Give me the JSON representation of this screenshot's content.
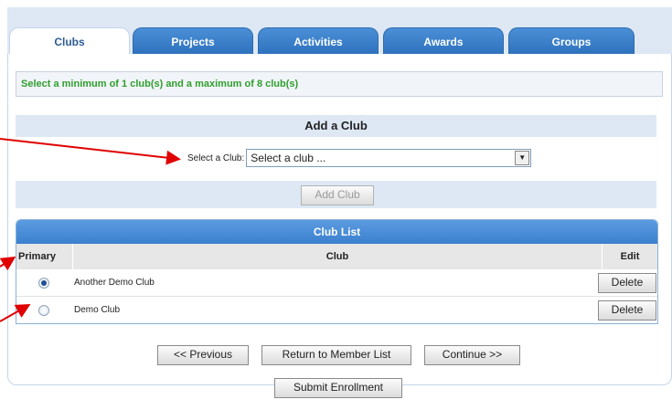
{
  "tabs": [
    {
      "label": "Clubs",
      "active": true
    },
    {
      "label": "Projects",
      "active": false
    },
    {
      "label": "Activities",
      "active": false
    },
    {
      "label": "Awards",
      "active": false
    },
    {
      "label": "Groups",
      "active": false
    }
  ],
  "notice": "Select a minimum of 1 club(s) and a maximum of 8 club(s)",
  "add_club": {
    "title": "Add a Club",
    "select_label": "Select a Club:",
    "select_value": "Select a club ...",
    "add_button": "Add Club"
  },
  "club_list": {
    "title": "Club List",
    "columns": {
      "primary": "Primary",
      "club": "Club",
      "edit": "Edit"
    },
    "rows": [
      {
        "name": "Another Demo Club",
        "primary": true,
        "delete": "Delete"
      },
      {
        "name": "Demo Club",
        "primary": false,
        "delete": "Delete"
      }
    ]
  },
  "buttons": {
    "previous": "<< Previous",
    "return": "Return to Member List",
    "continue": "Continue >>",
    "submit": "Submit Enrollment"
  },
  "colors": {
    "tab_blue": "#2f73bf",
    "notice_green": "#2f9f2f",
    "arrow_red": "#e00000",
    "header_band": "#dde8f4"
  }
}
